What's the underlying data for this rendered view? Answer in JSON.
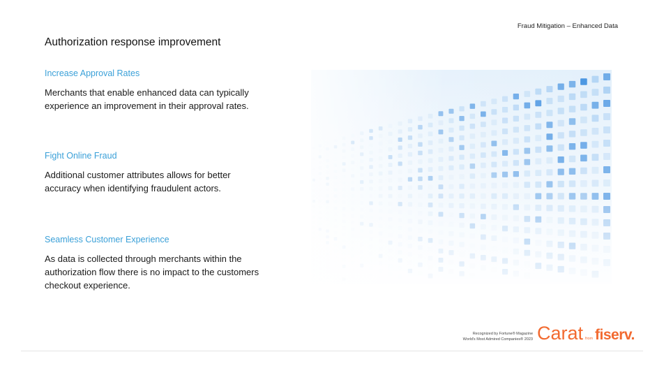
{
  "header": {
    "label": "Fraud Mitigation – Enhanced Data"
  },
  "title": "Authorization response improvement",
  "sections": [
    {
      "heading": "Increase Approval Rates",
      "body": "Merchants that enable enhanced data can typically experience an improvement in their approval rates."
    },
    {
      "heading": "Fight Online Fraud",
      "body": "Additional customer attributes allows for better accuracy when identifying fraudulent actors."
    },
    {
      "heading": "Seamless Customer Experience",
      "body": "As data is collected through merchants within the authorization flow there is no impact to the customers checkout experience."
    }
  ],
  "footer": {
    "recognition_line1": "Recognized by Fortune® Magazine",
    "recognition_line2": "World's Most Admired Companies® 2023",
    "brand_carat": "Carat",
    "brand_from": "from",
    "brand_fiserv": "fiserv."
  },
  "colors": {
    "accent_blue": "#3aa0d8",
    "brand_orange": "#f26a30"
  }
}
